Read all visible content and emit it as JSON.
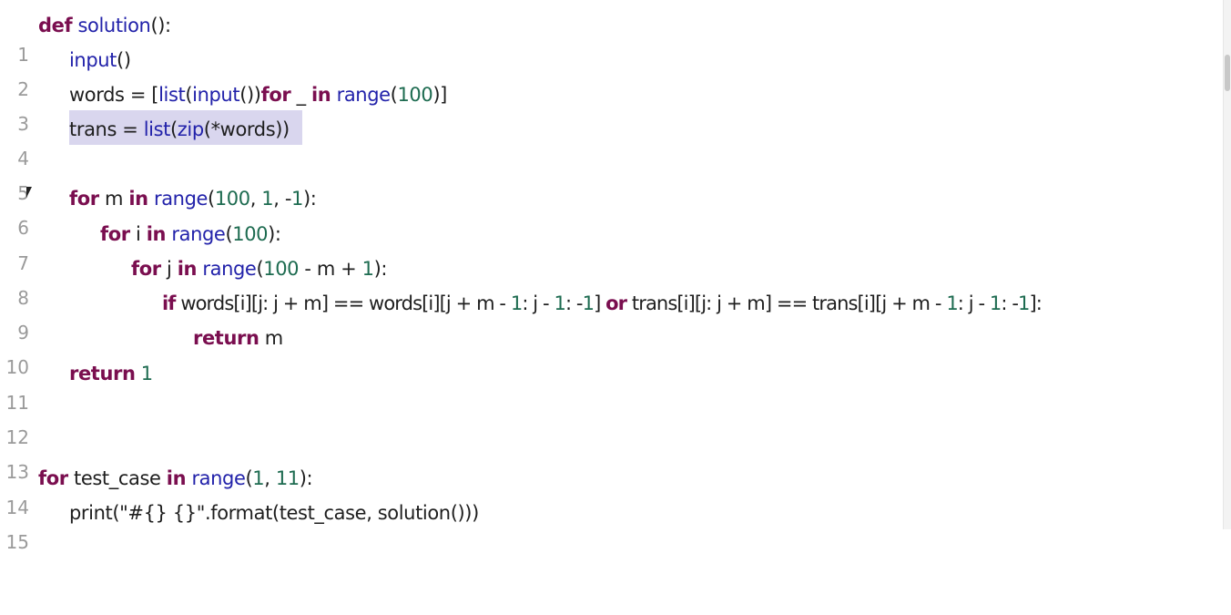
{
  "lines": [
    {
      "n": "1",
      "t1": "def",
      "t2": " ",
      "t3": "solution",
      "t4": "():"
    },
    {
      "n": "2",
      "t1": "input",
      "t2": "()"
    },
    {
      "n": "3",
      "a": "words = [",
      "b": "list",
      "c": "(",
      "d": "input",
      "e": "())",
      "f": "for",
      "g": " _ ",
      "h": "in",
      "i": " ",
      "j": "range",
      "k": "(",
      "l": "100",
      "m": ")]"
    },
    {
      "n": "4",
      "a": "trans = ",
      "b": "list",
      "c": "(",
      "d": "zip",
      "e": "(*words))"
    },
    {
      "n": "5"
    },
    {
      "n": "6",
      "a": "for",
      "b": " m ",
      "c": "in",
      "d": " ",
      "e": "range",
      "f": "(",
      "g": "100",
      "h": ", ",
      "i": "1",
      "j": ", -",
      "k": "1",
      "l": "):"
    },
    {
      "n": "7",
      "a": "for",
      "b": " i ",
      "c": "in",
      "d": " ",
      "e": "range",
      "f": "(",
      "g": "100",
      "h": "):"
    },
    {
      "n": "8",
      "a": "for",
      "b": " j ",
      "c": "in",
      "d": " ",
      "e": "range",
      "f": "(",
      "g": "100",
      "h": " - m + ",
      "i": "1",
      "j": "):"
    },
    {
      "n": "9",
      "a": "if",
      "b": " words[i][j: j + m] == words[i][j + m - ",
      "c": "1",
      "d": ": j - ",
      "e": "1",
      "f": ": -",
      "g": "1",
      "h": "] ",
      "i": "or",
      "j": " trans[i][j: j + m] == trans[i][j + m - ",
      "k": "1",
      "l": ": j - ",
      "m": "1",
      "o": ": -",
      "p": "1",
      "q": "]:"
    },
    {
      "n": "10",
      "a": "return",
      "b": " m"
    },
    {
      "n": "11",
      "a": "return",
      "b": " ",
      "c": "1"
    },
    {
      "n": "12"
    },
    {
      "n": "13"
    },
    {
      "n": "14",
      "a": "for",
      "b": " test_case ",
      "c": "in",
      "d": " ",
      "e": "range",
      "f": "(",
      "g": "1",
      "h": ", ",
      "i": "11",
      "j": "):"
    },
    {
      "n": "15",
      "a": "print",
      "b": "(\"#{} {}\".format(test_case, solution()))"
    }
  ],
  "colors": {
    "keyword": "#7a0e4f",
    "builtin": "#2222aa",
    "number": "#1d6b50",
    "text": "#1e1e1e",
    "line_number": "#9a9a9a",
    "selection": "#d9d6ee"
  }
}
